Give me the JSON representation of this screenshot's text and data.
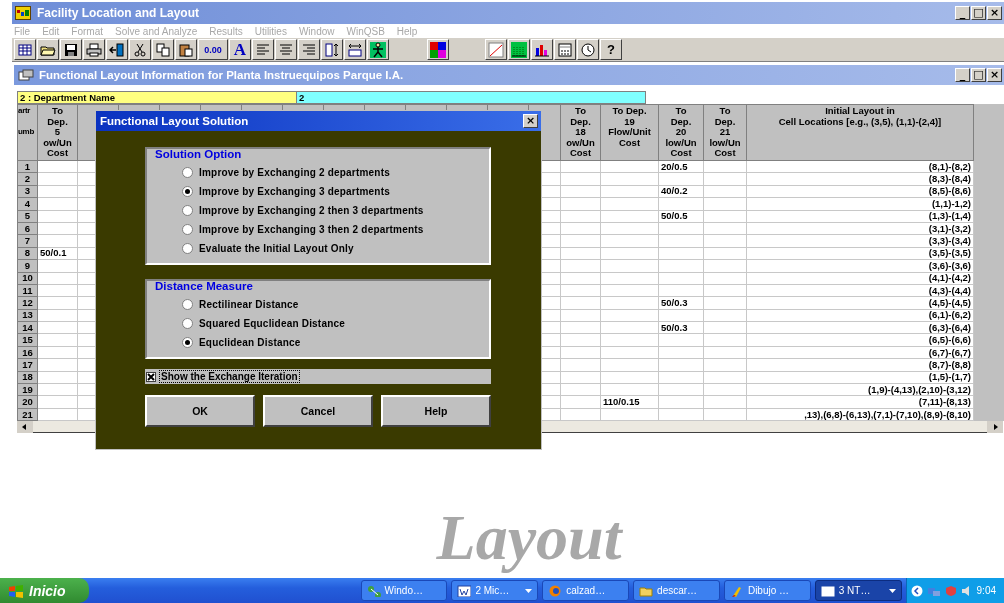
{
  "window": {
    "title": "Facility Location and Layout",
    "controls": [
      "_",
      "□",
      "×"
    ]
  },
  "menu": [
    {
      "label": "File",
      "disabled": true
    },
    {
      "label": "Edit",
      "disabled": true
    },
    {
      "label": "Format",
      "disabled": true
    },
    {
      "label": "Solve and Analyze",
      "disabled": true
    },
    {
      "label": "Results",
      "disabled": true
    },
    {
      "label": "Utilities",
      "disabled": true
    },
    {
      "label": "Window",
      "disabled": true
    },
    {
      "label": "WinQSB",
      "disabled": true
    },
    {
      "label": "Help",
      "disabled": true
    }
  ],
  "toolbar": [
    {
      "kind": "icon"
    },
    {
      "kind": "icon"
    },
    {
      "kind": "icon"
    },
    {
      "kind": "icon"
    },
    {
      "kind": "icon"
    },
    {
      "kind": "icon"
    },
    {
      "kind": "icon"
    },
    {
      "kind": "icon"
    },
    {
      "kind": "text",
      "label": "0.00"
    },
    {
      "kind": "text",
      "label": "A"
    },
    {
      "kind": "icon"
    },
    {
      "kind": "icon"
    },
    {
      "kind": "icon"
    },
    {
      "kind": "icon"
    },
    {
      "kind": "icon"
    },
    {
      "kind": "icon"
    },
    {
      "kind": "icon"
    },
    {
      "kind": "icon"
    },
    {
      "kind": "icon"
    },
    {
      "kind": "icon"
    },
    {
      "kind": "icon"
    },
    {
      "kind": "icon"
    },
    {
      "kind": "text",
      "label": "?"
    }
  ],
  "document": {
    "title": "Functional Layout Information for Planta Instruequipos Parque I.A.",
    "controls": [
      "_",
      "□",
      "×"
    ],
    "cell_label": "2 : Department Name",
    "cell_value": "2",
    "row_header_label": "artr\n\numb",
    "columns": [
      "To\nDep.\n5\now/Un\nCost",
      null,
      null,
      null,
      null,
      null,
      null,
      null,
      null,
      null,
      null,
      null,
      null,
      "To\nDep.\n18\now/Un\nCost",
      "To Dep.\n19\nFlow/Unit\nCost",
      "To\nDep.\n20\nlow/Un\nCost",
      "To\nDep.\n21\nlow/Un\nCost",
      "Initial Layout in\nCell Locations [e.g., (3,5), (1,1)-(2,4)]"
    ],
    "rows": [
      {
        "number": "1",
        "cells": [
          null,
          null,
          null,
          null,
          null,
          null,
          null,
          null,
          null,
          null,
          null,
          null,
          null,
          null,
          null,
          "20/0.5",
          null,
          "(8,1)-(8,2)"
        ]
      },
      {
        "number": "2",
        "cells": [
          null,
          null,
          null,
          null,
          null,
          null,
          null,
          null,
          null,
          null,
          null,
          null,
          null,
          null,
          null,
          null,
          null,
          "(8,3)-(8,4)"
        ]
      },
      {
        "number": "3",
        "cells": [
          null,
          null,
          null,
          null,
          null,
          null,
          null,
          null,
          null,
          null,
          null,
          null,
          null,
          null,
          null,
          "40/0.2",
          null,
          "(8,5)-(8,6)"
        ]
      },
      {
        "number": "4",
        "cells": [
          null,
          null,
          null,
          null,
          null,
          null,
          null,
          null,
          null,
          null,
          null,
          null,
          null,
          null,
          null,
          null,
          null,
          "(1,1)-1,2)"
        ]
      },
      {
        "number": "5",
        "cells": [
          null,
          null,
          null,
          null,
          null,
          null,
          null,
          null,
          null,
          null,
          null,
          null,
          null,
          null,
          null,
          "50/0.5",
          null,
          "(1,3)-(1,4)"
        ]
      },
      {
        "number": "6",
        "cells": [
          null,
          null,
          null,
          null,
          null,
          null,
          null,
          null,
          null,
          null,
          null,
          null,
          null,
          null,
          null,
          null,
          null,
          "(3,1)-(3,2)"
        ]
      },
      {
        "number": "7",
        "cells": [
          null,
          null,
          null,
          null,
          null,
          null,
          null,
          null,
          null,
          null,
          null,
          null,
          null,
          null,
          null,
          null,
          null,
          "(3,3)-(3,4)"
        ]
      },
      {
        "number": "8",
        "cells": [
          "50/0.1",
          null,
          null,
          null,
          null,
          null,
          null,
          null,
          null,
          null,
          null,
          null,
          null,
          null,
          null,
          null,
          null,
          "(3,5)-(3,5)"
        ]
      },
      {
        "number": "9",
        "cells": [
          null,
          null,
          null,
          null,
          null,
          null,
          null,
          null,
          null,
          null,
          null,
          null,
          null,
          null,
          null,
          null,
          null,
          "(3,6)-(3,6)"
        ]
      },
      {
        "number": "10",
        "cells": [
          null,
          null,
          null,
          null,
          null,
          null,
          null,
          null,
          null,
          null,
          null,
          null,
          null,
          null,
          null,
          null,
          null,
          "(4,1)-(4,2)"
        ]
      },
      {
        "number": "11",
        "cells": [
          null,
          null,
          null,
          null,
          null,
          null,
          null,
          null,
          null,
          null,
          null,
          null,
          null,
          null,
          null,
          null,
          null,
          "(4,3)-(4,4)"
        ]
      },
      {
        "number": "12",
        "cells": [
          null,
          null,
          null,
          null,
          null,
          null,
          null,
          null,
          null,
          null,
          null,
          null,
          null,
          null,
          null,
          "50/0.3",
          null,
          "(4,5)-(4,5)"
        ]
      },
      {
        "number": "13",
        "cells": [
          null,
          null,
          null,
          null,
          null,
          null,
          null,
          null,
          null,
          null,
          null,
          null,
          null,
          null,
          null,
          null,
          null,
          "(6,1)-(6,2)"
        ]
      },
      {
        "number": "14",
        "cells": [
          null,
          null,
          null,
          null,
          null,
          null,
          null,
          null,
          null,
          null,
          null,
          null,
          null,
          null,
          null,
          "50/0.3",
          null,
          "(6,3)-(6,4)"
        ]
      },
      {
        "number": "15",
        "cells": [
          null,
          null,
          null,
          null,
          null,
          null,
          null,
          null,
          null,
          null,
          null,
          null,
          null,
          null,
          null,
          null,
          null,
          "(6,5)-(6,6)"
        ]
      },
      {
        "number": "16",
        "cells": [
          null,
          null,
          null,
          null,
          null,
          null,
          null,
          null,
          null,
          null,
          null,
          null,
          null,
          null,
          null,
          null,
          null,
          "(6,7)-(6,7)"
        ]
      },
      {
        "number": "17",
        "cells": [
          null,
          null,
          null,
          null,
          null,
          null,
          null,
          null,
          null,
          null,
          null,
          null,
          null,
          null,
          null,
          null,
          null,
          "(8,7)-(8,8)"
        ]
      },
      {
        "number": "18",
        "cells": [
          null,
          null,
          null,
          null,
          null,
          null,
          null,
          null,
          null,
          null,
          null,
          null,
          null,
          null,
          null,
          null,
          null,
          "(1,5)-(1,7)"
        ]
      },
      {
        "number": "19",
        "cells": [
          null,
          null,
          null,
          null,
          null,
          null,
          null,
          null,
          null,
          null,
          null,
          null,
          null,
          null,
          null,
          null,
          null,
          "(1,9)-(4,13),(2,10)-(3,12)"
        ]
      },
      {
        "number": "20",
        "cells": [
          null,
          null,
          null,
          null,
          null,
          null,
          null,
          null,
          null,
          null,
          null,
          null,
          null,
          null,
          "110/0.15",
          null,
          null,
          "(7,11)-(8,13)"
        ]
      },
      {
        "number": "21",
        "cells": [
          null,
          null,
          null,
          null,
          null,
          null,
          null,
          null,
          null,
          null,
          null,
          null,
          null,
          null,
          null,
          null,
          null,
          ",13),(6,8)-(6,13),(7,1)-(7,10),(8,9)-(8,10)"
        ]
      }
    ]
  },
  "background_logo": "Layout",
  "dialog": {
    "title": "Functional Layout Solution",
    "close": "×",
    "groups": [
      {
        "title": "Solution Option",
        "options": [
          {
            "label": "Improve by Exchanging 2 departments",
            "selected": false
          },
          {
            "label": "Improve by Exchanging 3 departments",
            "selected": true
          },
          {
            "label": "Improve by Exchanging 2 then 3 departments",
            "selected": false
          },
          {
            "label": "Improve by Exchanging 3 then 2 departments",
            "selected": false
          },
          {
            "label": "Evaluate the Initial Layout Only",
            "selected": false
          }
        ]
      },
      {
        "title": "Distance Measure",
        "options": [
          {
            "label": "Rectilinear Distance",
            "selected": false
          },
          {
            "label": "Squared Equclidean Distance",
            "selected": false
          },
          {
            "label": "Equclidean Distance",
            "selected": true
          }
        ]
      }
    ],
    "checkbox": {
      "label": "Show the Exchange Iteration",
      "checked": true
    },
    "buttons": [
      "OK",
      "Cancel",
      "Help"
    ]
  },
  "taskbar": {
    "start": "Inicio",
    "tasks": [
      {
        "label": "Windo…",
        "selected": false,
        "has_menu": false
      },
      {
        "label": "2 Mic…",
        "selected": false,
        "has_menu": true
      },
      {
        "label": "calzad…",
        "selected": false,
        "has_menu": false
      },
      {
        "label": "descar…",
        "selected": false,
        "has_menu": false
      },
      {
        "label": "Dibujo …",
        "selected": false,
        "has_menu": false
      },
      {
        "label": "3 NT…",
        "selected": true,
        "has_menu": true
      }
    ],
    "clock": "9:04"
  }
}
